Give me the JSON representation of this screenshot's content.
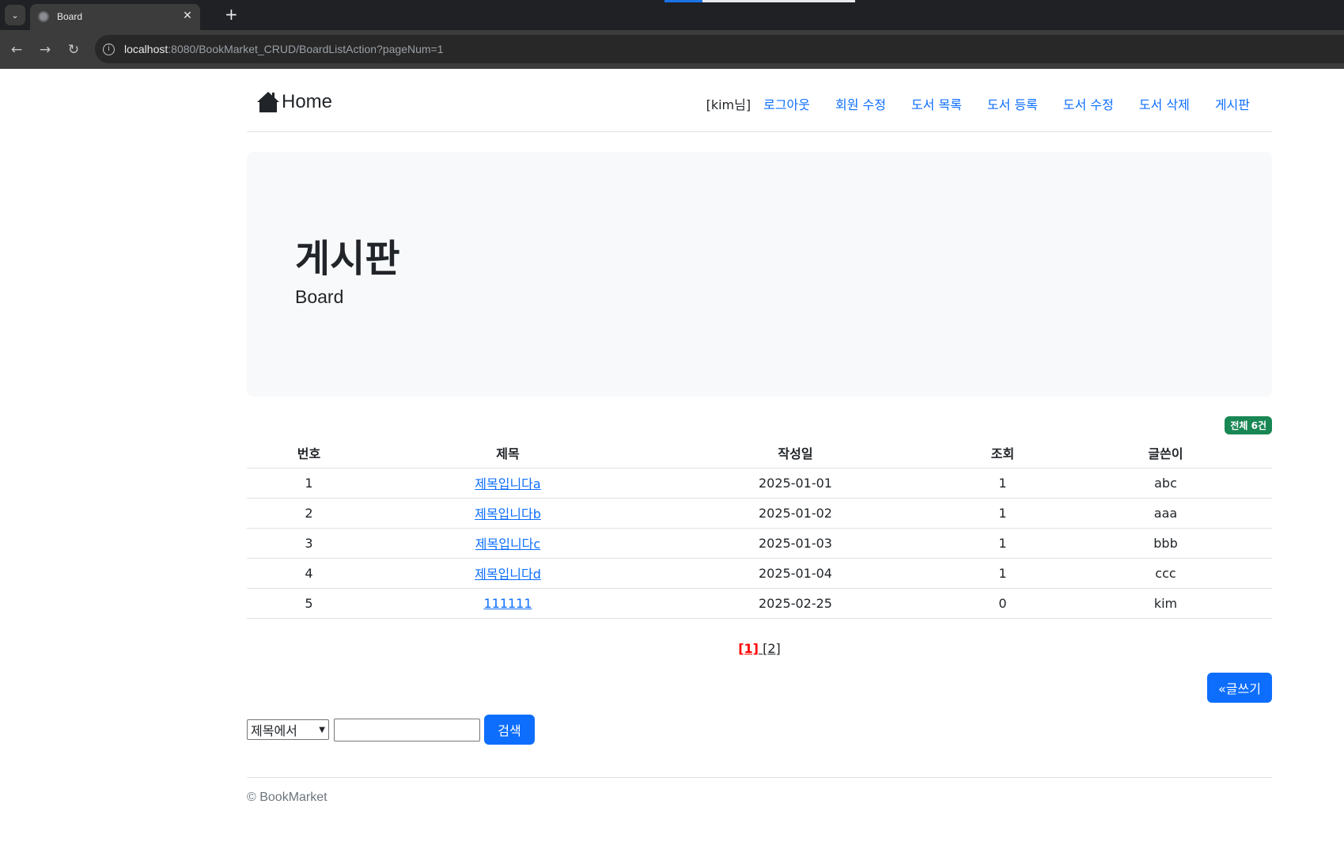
{
  "browser": {
    "tab_title": "Board",
    "url_host": "localhost",
    "url_rest": ":8080/BookMarket_CRUD/BoardListAction?pageNum=1"
  },
  "nav": {
    "brand": "Home",
    "user": "[kim님]",
    "links": [
      "로그아웃",
      "회원 수정",
      "도서 목록",
      "도서 등록",
      "도서 수정",
      "도서 삭제",
      "게시판"
    ]
  },
  "jumbotron": {
    "title": "게시판",
    "subtitle": "Board"
  },
  "badge": "전체 6건",
  "table": {
    "headers": [
      "번호",
      "제목",
      "작성일",
      "조회",
      "글쓴이"
    ],
    "rows": [
      {
        "no": "1",
        "title": "제목입니다a",
        "date": "2025-01-01",
        "hits": "1",
        "writer": "abc"
      },
      {
        "no": "2",
        "title": "제목입니다b",
        "date": "2025-01-02",
        "hits": "1",
        "writer": "aaa"
      },
      {
        "no": "3",
        "title": "제목입니다c",
        "date": "2025-01-03",
        "hits": "1",
        "writer": "bbb"
      },
      {
        "no": "4",
        "title": "제목입니다d",
        "date": "2025-01-04",
        "hits": "1",
        "writer": "ccc"
      },
      {
        "no": "5",
        "title": "111111",
        "date": "2025-02-25",
        "hits": "0",
        "writer": "kim"
      }
    ]
  },
  "pagination": {
    "current": "[1]",
    "pages": [
      "[2]"
    ]
  },
  "write_button": "«글쓰기",
  "search": {
    "select_value": "제목에서",
    "input_value": "",
    "button": "검색"
  },
  "footer": "© BookMarket",
  "colors": {
    "primary": "#0d6efd",
    "success": "#198754",
    "jumbotron_bg": "#f8f9fa",
    "current_page": "#ff0000"
  }
}
